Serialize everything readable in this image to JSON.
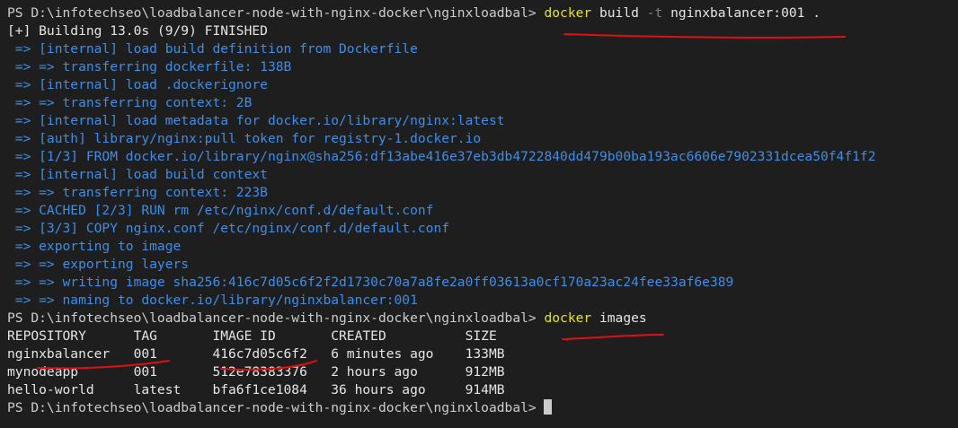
{
  "prompt": "PS D:\\infotechseo\\loadbalancer-node-with-nginx-docker\\nginxloadbal> ",
  "build_cmd": {
    "docker": "docker",
    "rest1": " build ",
    "flag": "-t",
    "rest2": " nginxbalancer:001 ."
  },
  "build_status": "[+] Building 13.0s (9/9) FINISHED",
  "build_steps": [
    " => [internal] load build definition from Dockerfile",
    " => => transferring dockerfile: 138B",
    " => [internal] load .dockerignore",
    " => => transferring context: 2B",
    " => [internal] load metadata for docker.io/library/nginx:latest",
    " => [auth] library/nginx:pull token for registry-1.docker.io",
    " => [1/3] FROM docker.io/library/nginx@sha256:df13abe416e37eb3db4722840dd479b00ba193ac6606e7902331dcea50f4f1f2",
    " => [internal] load build context",
    " => => transferring context: 223B",
    " => CACHED [2/3] RUN rm /etc/nginx/conf.d/default.conf",
    " => [3/3] COPY nginx.conf /etc/nginx/conf.d/default.conf",
    " => exporting to image",
    " => => exporting layers",
    " => => writing image sha256:416c7d05c6f2f2d1730c70a7a8fe2a0ff03613a0cf170a23ac24fee33af6e389",
    " => => naming to docker.io/library/nginxbalancer:001"
  ],
  "images_cmd": {
    "docker": "docker",
    "rest": " images"
  },
  "images_table": {
    "header": "REPOSITORY      TAG       IMAGE ID       CREATED          SIZE",
    "rows": [
      "nginxbalancer   001       416c7d05c6f2   6 minutes ago    133MB",
      "mynodeapp       001       512e78383376   2 hours ago      912MB",
      "hello-world     latest    bfa6f1ce1084   36 hours ago     914MB"
    ]
  },
  "colors": {
    "background": "#1e1e1e",
    "text": "#cccccc",
    "command": "#e5e510",
    "build_steps": "#3b8eea",
    "flag": "#808080",
    "annotation": "#e01010"
  },
  "icons": {
    "cursor": "block-cursor-icon"
  }
}
